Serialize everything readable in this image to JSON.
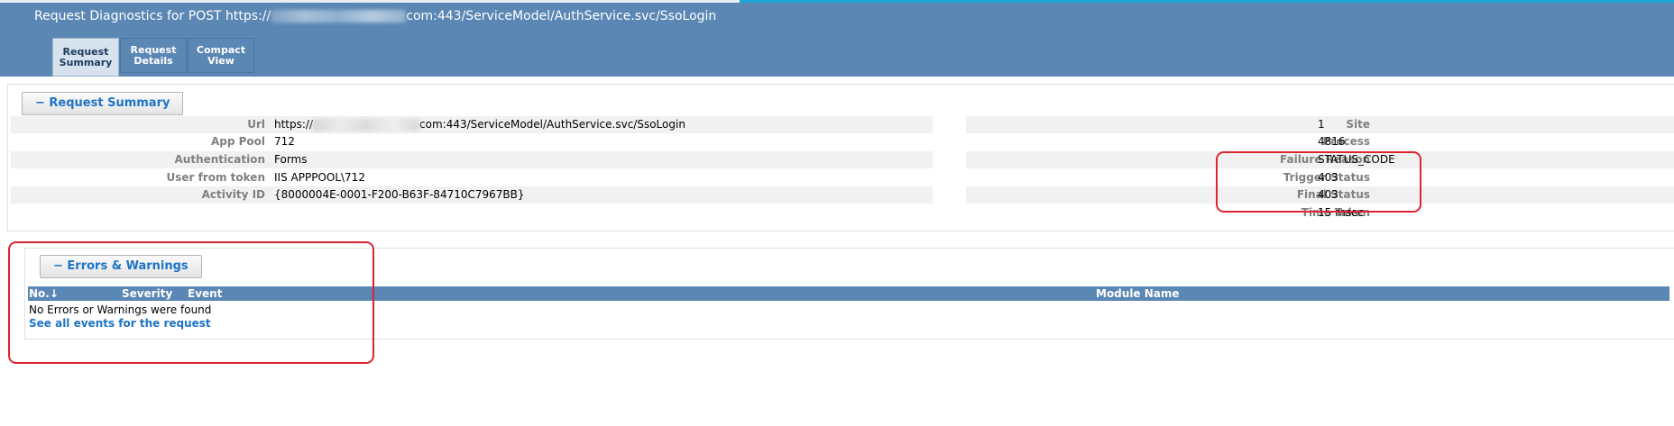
{
  "header": {
    "title_prefix": "Request Diagnostics for POST https://",
    "title_suffix": "com:443/ServiceModel/AuthService.svc/SsoLogin",
    "tabs": [
      {
        "line1": "Request",
        "line2": "Summary"
      },
      {
        "line1": "Request",
        "line2": "Details"
      },
      {
        "line1": "Compact",
        "line2": "View"
      }
    ]
  },
  "summary": {
    "toggle_label": "−  Request Summary",
    "left": [
      {
        "label": "Url",
        "value_prefix": "https://",
        "value_suffix": "com:443/ServiceModel/AuthService.svc/SsoLogin"
      },
      {
        "label": "App Pool",
        "value": "712"
      },
      {
        "label": "Authentication",
        "value": "Forms"
      },
      {
        "label": "User from token",
        "value": "IIS APPPOOL\\712"
      },
      {
        "label": "Activity ID",
        "value": "{8000004E-0001-F200-B63F-84710C7967BB}"
      }
    ],
    "right": [
      {
        "label": "Site",
        "value": "1"
      },
      {
        "label": "Process",
        "value": "4816"
      },
      {
        "label": "Failure Reason",
        "value": "STATUS_CODE"
      },
      {
        "label": "Trigger Status",
        "value": "403"
      },
      {
        "label": "Final Status",
        "value": "403"
      },
      {
        "label": "Time Taken",
        "value": "15 msec"
      }
    ]
  },
  "errors": {
    "toggle_label": "−  Errors & Warnings",
    "columns": {
      "no": "No.↓",
      "severity": "Severity",
      "event": "Event",
      "module": "Module Name"
    },
    "empty_message": "No Errors or Warnings were found",
    "link_label": "See all events for the request"
  },
  "colors": {
    "header": "#5b87b4",
    "accent": "#1d74c7",
    "highlight": "#e0232e"
  }
}
